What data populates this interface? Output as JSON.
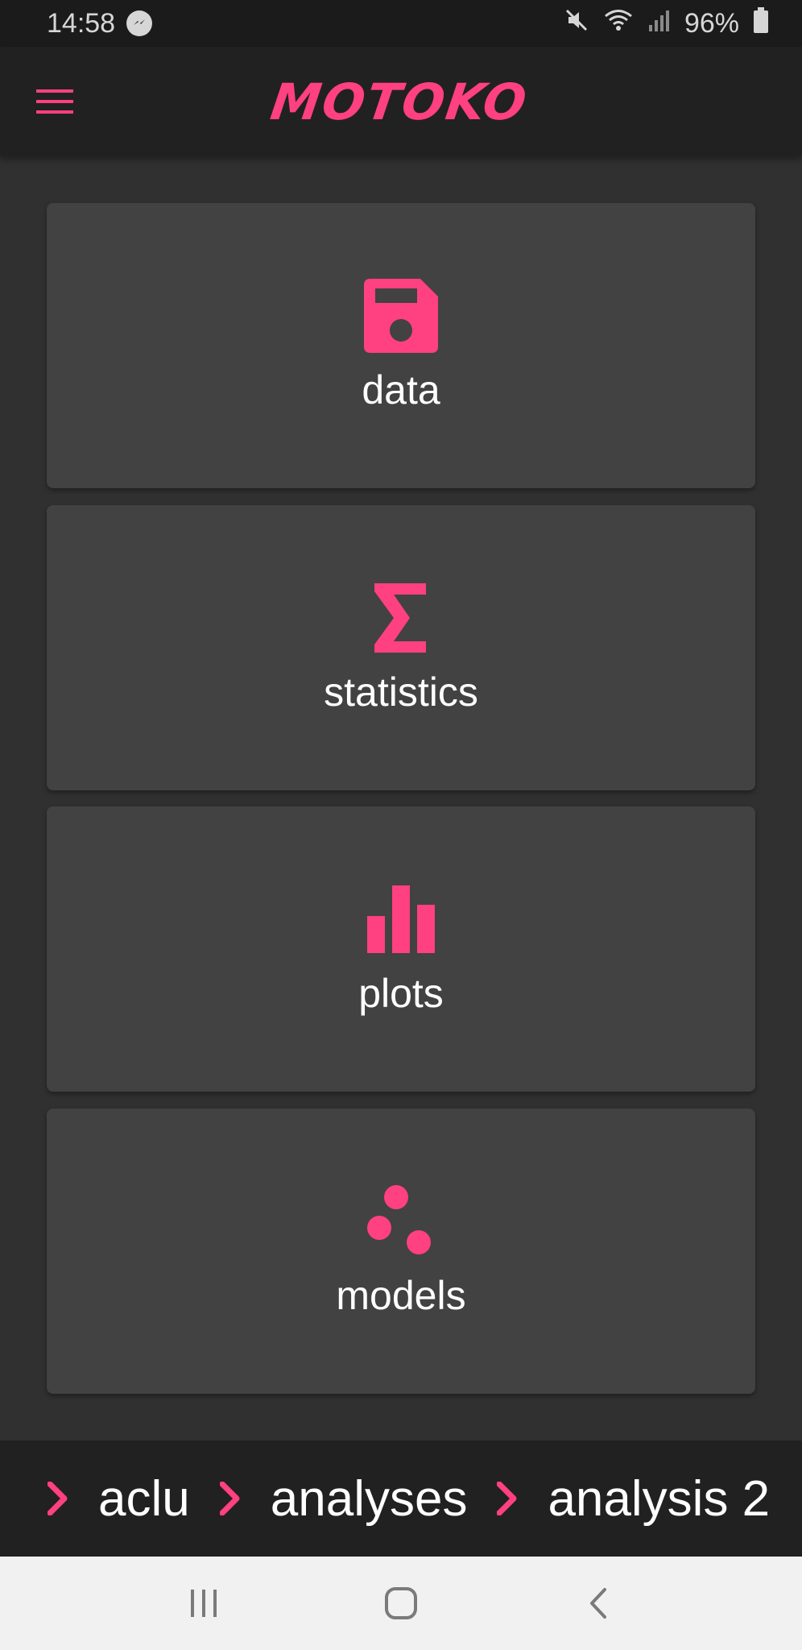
{
  "status_bar": {
    "time": "14:58",
    "battery": "96%",
    "icons": [
      "messenger-icon",
      "mute-icon",
      "wifi-icon",
      "signal-icon",
      "battery-icon"
    ]
  },
  "app_bar": {
    "logo_text": "MOTOKO",
    "menu_icon": "hamburger-menu-icon"
  },
  "cards": [
    {
      "label": "data",
      "icon": "floppy-disk-icon"
    },
    {
      "label": "statistics",
      "icon": "sigma-icon"
    },
    {
      "label": "plots",
      "icon": "bar-chart-icon"
    },
    {
      "label": "models",
      "icon": "scatter-dots-icon"
    }
  ],
  "breadcrumb": {
    "items": [
      "aclu",
      "analyses",
      "analysis 2"
    ]
  },
  "nav_bar": {
    "icons": [
      "recent-apps-icon",
      "home-icon",
      "back-icon"
    ]
  },
  "colors": {
    "accent": "#ff4081",
    "background": "#303030",
    "card": "#424242",
    "app_bar": "#212121",
    "status_bar": "#1b1b1b",
    "nav_bar": "#f1f1f1"
  }
}
